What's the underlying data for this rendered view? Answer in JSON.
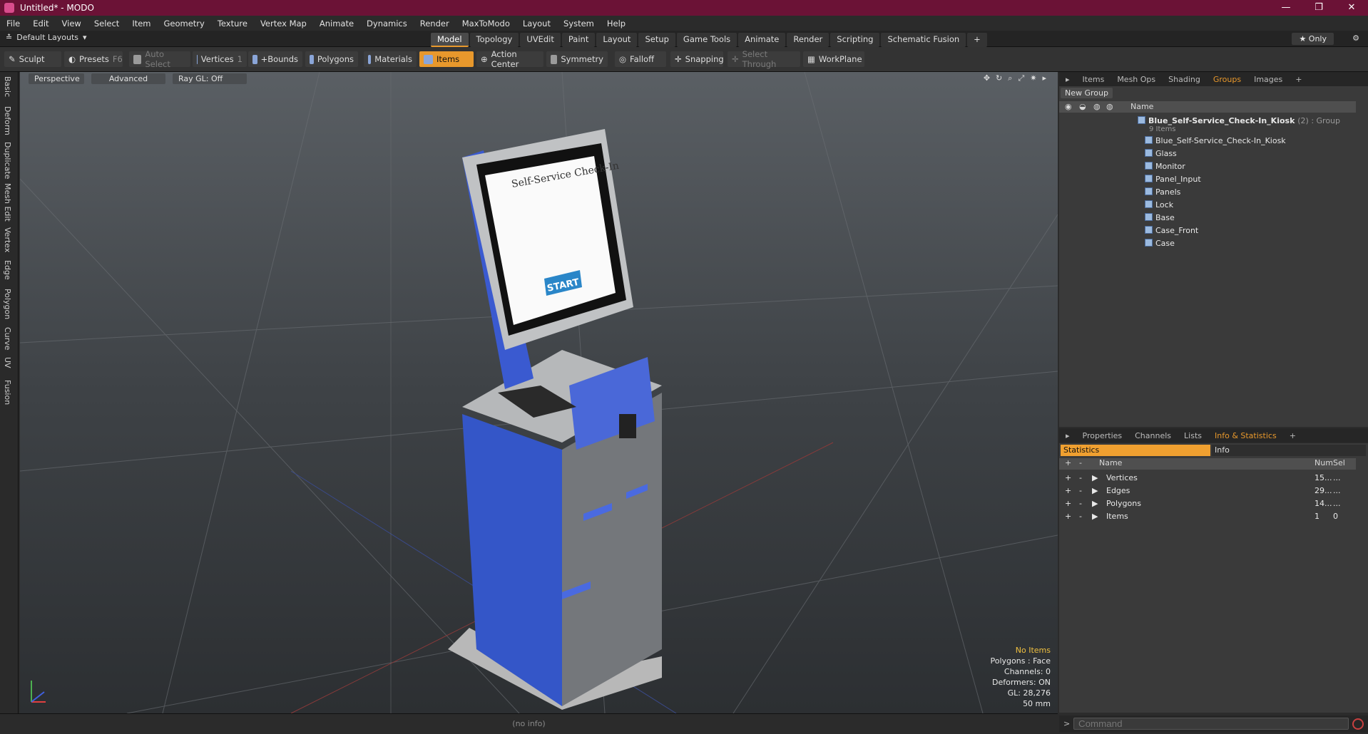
{
  "window": {
    "title": "Untitled* - MODO",
    "controls": [
      "—",
      "❐",
      "✕"
    ]
  },
  "menu": [
    "File",
    "Edit",
    "View",
    "Select",
    "Item",
    "Geometry",
    "Texture",
    "Vertex Map",
    "Animate",
    "Dynamics",
    "Render",
    "MaxToModo",
    "Layout",
    "System",
    "Help"
  ],
  "layoutbar": {
    "layouts_label": "Default Layouts",
    "tabs": [
      "Model",
      "Topology",
      "UVEdit",
      "Paint",
      "Layout",
      "Setup",
      "Game Tools",
      "Animate",
      "Render",
      "Scripting",
      "Schematic Fusion"
    ],
    "active_tab": "Model",
    "only_label": "Only"
  },
  "toolbar": {
    "sculpt": "Sculpt",
    "presets": "Presets",
    "presets_key": "F6",
    "auto_select": "Auto Select",
    "vertices": "Vertices",
    "vertices_count": "1",
    "bounds": "+Bounds",
    "polygons": "Polygons",
    "materials": "Materials",
    "items": "Items",
    "action_center": "Action Center",
    "symmetry": "Symmetry",
    "falloff": "Falloff",
    "snapping": "Snapping",
    "select_through": "Select Through",
    "workplane": "WorkPlane"
  },
  "left_tabs": [
    "Basic",
    "Deform",
    "Duplicate",
    "Mesh Edit",
    "Vertex",
    "Edge",
    "Polygon",
    "Curve",
    "UV",
    "Fusion"
  ],
  "viewport": {
    "view": "Perspective",
    "shading": "Advanced",
    "raygl": "Ray GL: Off",
    "screen_title": "Self-Service Check-In",
    "screen_button": "START",
    "info": {
      "no_items": "No Items",
      "polygons": "Polygons : Face",
      "channels": "Channels: 0",
      "deformers": "Deformers: ON",
      "gl": "GL: 28,276",
      "focal": "50 mm"
    }
  },
  "status": "(no info)",
  "groups_panel": {
    "tabs": [
      "Items",
      "Mesh Ops",
      "Shading",
      "Groups",
      "Images"
    ],
    "active_tab": "Groups",
    "new_group": "New Group",
    "name_header": "Name",
    "root": {
      "name": "Blue_Self-Service_Check-In_Kiosk",
      "suffix": "(2) : Group",
      "count": "9 Items"
    },
    "children": [
      "Blue_Self-Service_Check-In_Kiosk",
      "Glass",
      "Monitor",
      "Panel_Input",
      "Panels",
      "Lock",
      "Base",
      "Case_Front",
      "Case"
    ]
  },
  "stats_panel": {
    "tabs": [
      "Properties",
      "Channels",
      "Lists",
      "Info & Statistics"
    ],
    "active_tab": "Info & Statistics",
    "statistics_tab": "Statistics",
    "info_tab": "Info",
    "headers": [
      "Name",
      "Num",
      "Sel"
    ],
    "rows": [
      {
        "name": "Vertices",
        "num": "15...",
        "sel": "..."
      },
      {
        "name": "Edges",
        "num": "29...",
        "sel": "..."
      },
      {
        "name": "Polygons",
        "num": "14...",
        "sel": "..."
      },
      {
        "name": "Items",
        "num": "1",
        "sel": "0"
      }
    ]
  },
  "command": {
    "placeholder": "Command"
  }
}
